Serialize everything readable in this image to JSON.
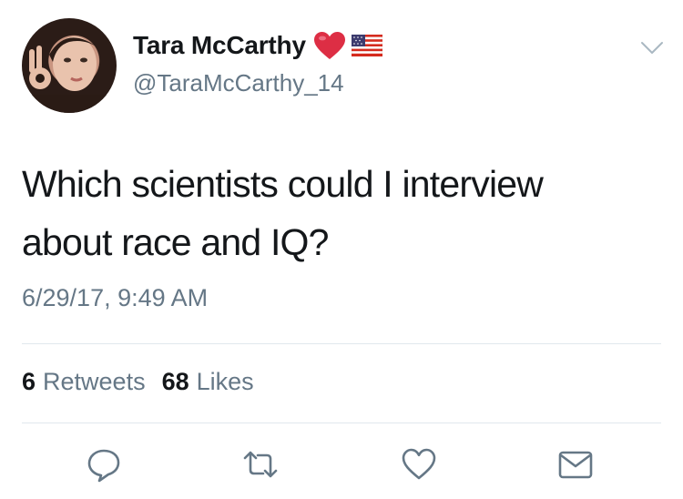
{
  "tweet": {
    "author": {
      "display_name": "Tara McCarthy",
      "handle": "@TaraMcCarthy_14",
      "name_emojis": [
        "red-heart",
        "us-flag"
      ]
    },
    "text_line1": "Which scientists could I interview",
    "text_line2": "about race and IQ?",
    "timestamp": "6/29/17, 9:49 AM",
    "stats": {
      "retweets_count": "6",
      "retweets_label": "Retweets",
      "likes_count": "68",
      "likes_label": "Likes"
    },
    "actions": [
      "reply-icon",
      "retweet-icon",
      "like-icon",
      "direct-message-icon"
    ]
  },
  "colors": {
    "text": "#14171a",
    "secondary": "#657786",
    "divider": "#e1e8ed",
    "heart": "#e0245e"
  }
}
